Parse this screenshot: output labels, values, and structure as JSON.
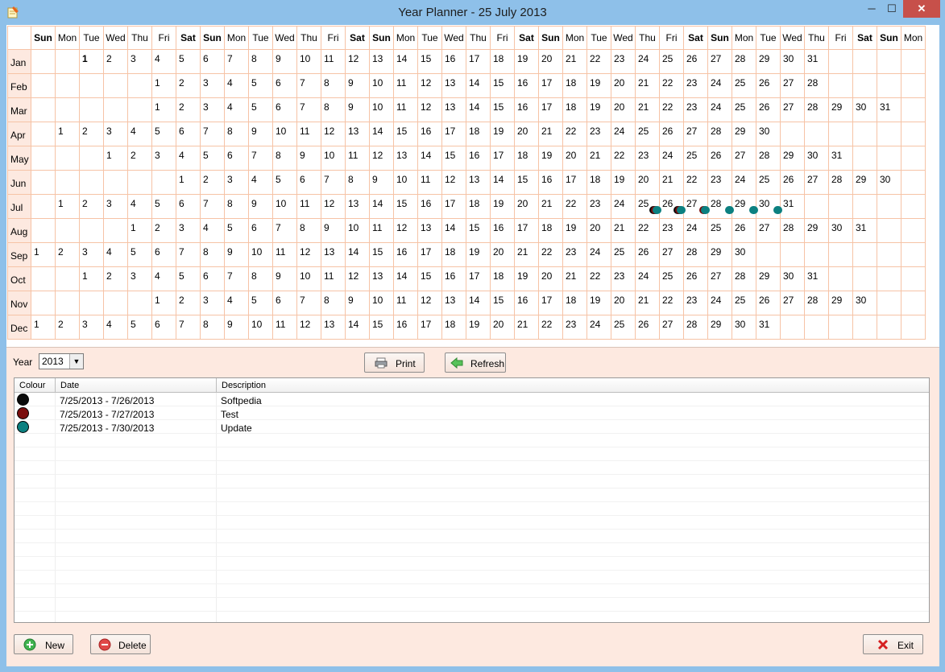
{
  "window": {
    "title": "Year Planner - 25 July 2013",
    "min": "─",
    "max": "☐",
    "close": "✕"
  },
  "grid": {
    "day_headers": [
      "Sun",
      "Mon",
      "Tue",
      "Wed",
      "Thu",
      "Fri",
      "Sat",
      "Sun",
      "Mon",
      "Tue",
      "Wed",
      "Thu",
      "Fri",
      "Sat",
      "Sun",
      "Mon",
      "Tue",
      "Wed",
      "Thu",
      "Fri",
      "Sat",
      "Sun",
      "Mon",
      "Tue",
      "Wed",
      "Thu",
      "Fri",
      "Sat",
      "Sun",
      "Mon",
      "Tue",
      "Wed",
      "Thu",
      "Fri",
      "Sat",
      "Sun",
      "Mon"
    ],
    "months": [
      {
        "label": "Jan",
        "offset": 2,
        "days": 31
      },
      {
        "label": "Feb",
        "offset": 5,
        "days": 28
      },
      {
        "label": "Mar",
        "offset": 5,
        "days": 31
      },
      {
        "label": "Apr",
        "offset": 1,
        "days": 30
      },
      {
        "label": "May",
        "offset": 3,
        "days": 31
      },
      {
        "label": "Jun",
        "offset": 6,
        "days": 30
      },
      {
        "label": "Jul",
        "offset": 1,
        "days": 31
      },
      {
        "label": "Aug",
        "offset": 4,
        "days": 31
      },
      {
        "label": "Sep",
        "offset": 0,
        "days": 30
      },
      {
        "label": "Oct",
        "offset": 2,
        "days": 31
      },
      {
        "label": "Nov",
        "offset": 5,
        "days": 30
      },
      {
        "label": "Dec",
        "offset": 0,
        "days": 31
      }
    ]
  },
  "controls": {
    "year_label": "Year",
    "year_value": "2013",
    "print_label": "Print",
    "refresh_label": "Refresh"
  },
  "list": {
    "columns": [
      "Colour",
      "Date",
      "Description"
    ],
    "events": [
      {
        "colour": "#0a0a0a",
        "date": "7/25/2013 - 7/26/2013",
        "description": "Softpedia",
        "start": "2013-07-25",
        "end": "2013-07-26"
      },
      {
        "colour": "#7a0c0c",
        "date": "7/25/2013 - 7/27/2013",
        "description": "Test",
        "start": "2013-07-25",
        "end": "2013-07-27"
      },
      {
        "colour": "#0c8080",
        "date": "7/25/2013 - 7/30/2013",
        "description": "Update",
        "start": "2013-07-25",
        "end": "2013-07-30"
      }
    ]
  },
  "buttons": {
    "new_label": "New",
    "delete_label": "Delete",
    "exit_label": "Exit"
  },
  "colors": {
    "accent": "#8ec0e9",
    "grid_line": "#f6c3a6",
    "panel": "#fde9e0"
  }
}
